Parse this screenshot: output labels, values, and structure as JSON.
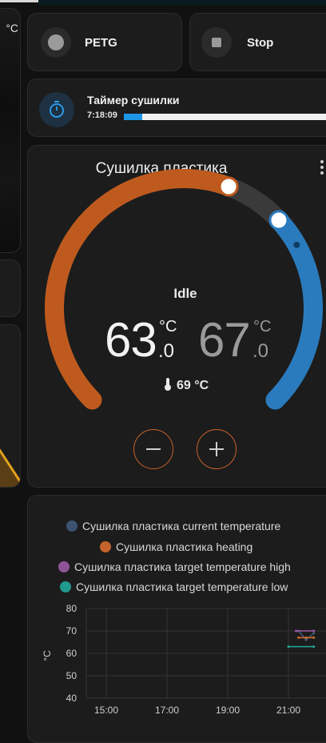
{
  "left_panel": {
    "unit": "°C"
  },
  "chips": [
    {
      "label": "PETG",
      "icon": "circle-icon"
    },
    {
      "label": "Stop",
      "icon": "stop-icon"
    }
  ],
  "timer": {
    "title": "Таймер сушилки",
    "value": "7:18:09",
    "progress": 0.09,
    "icon": "timer-icon"
  },
  "thermostat": {
    "title": "Сушилка пластика",
    "state": "Idle",
    "low_int": "63",
    "low_unit": "°C",
    "low_dec": ".0",
    "high_int": "67",
    "high_unit": "°C",
    "high_dec": ".0",
    "current": "69 °C",
    "min": 40,
    "max": 80,
    "low_setpoint": 63,
    "high_setpoint": 67,
    "current_value": 69,
    "colors": {
      "heat": "#bf5a1e",
      "cool": "#2a7bbd",
      "track": "#3a3a3a"
    }
  },
  "history": {
    "legend": [
      {
        "label": "Сушилка пластика current temperature",
        "color": "#3f5a78"
      },
      {
        "label": "Сушилка пластика heating",
        "color": "#d76b2d"
      },
      {
        "label": "Сушилка пластика target temperature high",
        "color": "#9c5ba6"
      },
      {
        "label": "Сушилка пластика target temperature low",
        "color": "#21a89b"
      }
    ],
    "y_unit": "°C",
    "y_ticks": [
      "80",
      "70",
      "60",
      "50",
      "40"
    ],
    "x_ticks": [
      "15:00",
      "17:00",
      "19:00",
      "21:00"
    ]
  },
  "chart_data": {
    "type": "line",
    "xlabel": "",
    "ylabel": "°C",
    "ylim": [
      40,
      80
    ],
    "x_ticks": [
      "15:00",
      "17:00",
      "19:00",
      "21:00"
    ],
    "series": [
      {
        "name": "Сушилка пластика current temperature",
        "x": [
          "21:20",
          "21:35",
          "21:50"
        ],
        "values": [
          70,
          66,
          69
        ]
      },
      {
        "name": "Сушилка пластика heating",
        "x": [
          "21:20",
          "21:35",
          "21:50"
        ],
        "values": [
          67,
          67,
          67
        ]
      },
      {
        "name": "Сушилка пластика target temperature high",
        "x": [
          "21:15",
          "21:50"
        ],
        "values": [
          70,
          70
        ]
      },
      {
        "name": "Сушилка пластика target temperature low",
        "x": [
          "21:00",
          "21:50"
        ],
        "values": [
          63,
          63
        ]
      }
    ]
  }
}
